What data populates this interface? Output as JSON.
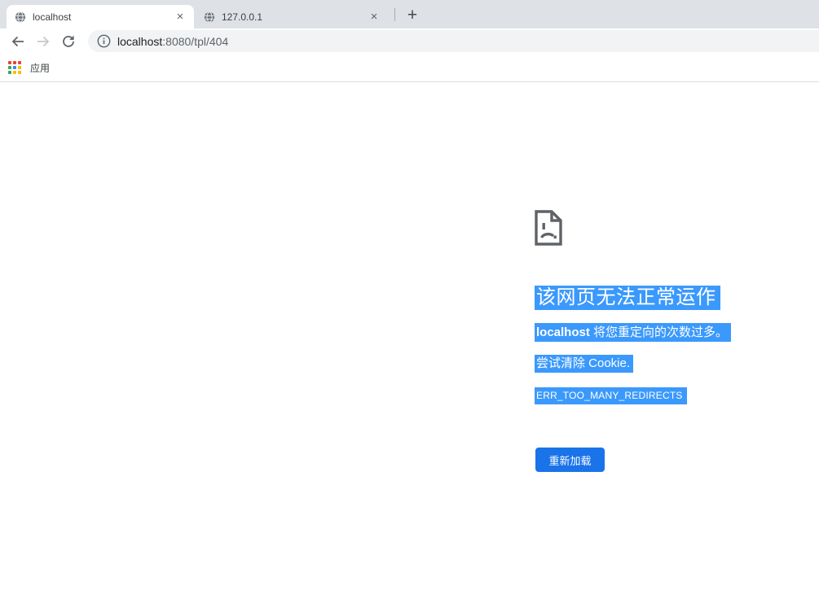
{
  "tabstrip": {
    "tabs": [
      {
        "title": "localhost",
        "active": true
      },
      {
        "title": "127.0.0.1",
        "active": false
      }
    ]
  },
  "icons": {
    "close_glyph": "×",
    "new_tab_glyph": "+"
  },
  "toolbar": {
    "url_host": "localhost",
    "url_rest": ":8080/tpl/404"
  },
  "bookmarks_bar": {
    "apps_label": "应用"
  },
  "error_page": {
    "title": "该网页无法正常运作",
    "message_host": "localhost",
    "message_rest": " 将您重定向的次数过多。",
    "suggestion": "尝试清除 Cookie.",
    "error_code": "ERR_TOO_MANY_REDIRECTS",
    "reload_button_label": "重新加载"
  },
  "colors": {
    "selection_highlight": "#3b99fc",
    "reload_button": "#1a73e8",
    "tabstrip_bg": "#dee1e6",
    "urlbar_bg": "#f1f3f4",
    "icon_gray": "#5f6368",
    "apps_icon_colors": [
      "#ea4335",
      "#ea4335",
      "#ea4335",
      "#34a853",
      "#4285f4",
      "#fbbc04",
      "#34a853",
      "#fbbc04",
      "#fbbc04"
    ]
  }
}
